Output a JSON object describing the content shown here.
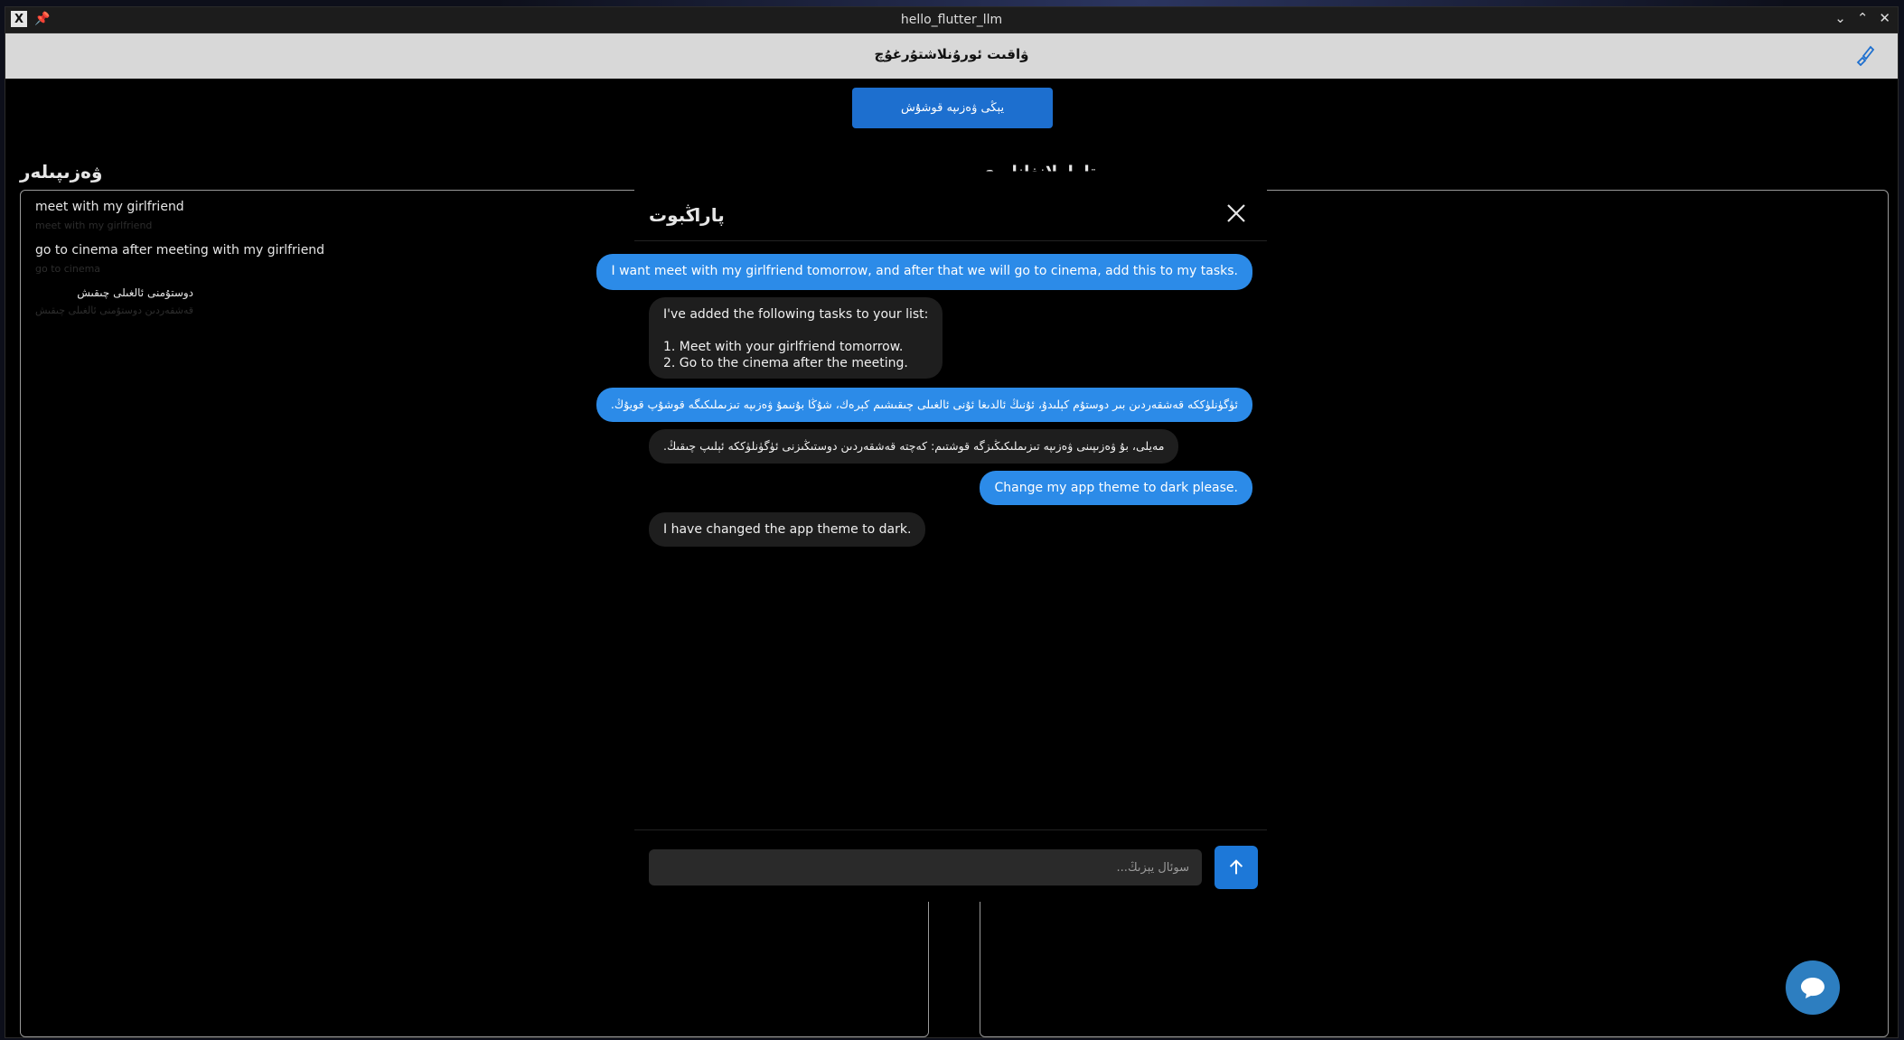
{
  "window": {
    "title": "hello_flutter_llm"
  },
  "appbar": {
    "title": "ۋاقىت ئورۇنلاشتۇرغۇچ"
  },
  "actions": {
    "add_task_label": "يېڭى ۋەزىپە قوشۇش"
  },
  "tasks": {
    "heading": "ۋەزىپىلەر",
    "items": [
      {
        "title": "meet with my girlfriend",
        "subtitle": "meet with my girlfriend"
      },
      {
        "title": "go to cinema after meeting with my girlfriend",
        "subtitle": "go to cinema"
      },
      {
        "title": "دوستۇمنى ئالغىلى چىقىش",
        "subtitle": "قەشقەردىن دوستۇمنى ئالغىلى چىقىش"
      }
    ]
  },
  "right_panel": {
    "heading": "تاماملانغانلىرى"
  },
  "chat": {
    "title": "پاراڭبوت",
    "messages": [
      {
        "role": "user",
        "text": "I want meet with my girlfriend tomorrow, and after that we will go to cinema, add this to my tasks."
      },
      {
        "role": "bot",
        "lines": [
          "I've added the following tasks to your list:",
          "",
          "1. Meet with your girlfriend tomorrow.",
          "2. Go to the cinema after the meeting."
        ]
      },
      {
        "role": "user",
        "text": "ئۈگۈنلۈككە قەشقەردىن بىر دوستۇم كېلىدۇ، ئۇنىڭ ئالدىغا ئۇنى ئالغىلى چىقىشىم كېرەك، شۇڭا بۇنىمۇ ۋەزىپە تىزىملىكىگە قوشۇپ قويۇڭ."
      },
      {
        "role": "bot",
        "text": "مەيلى، بۇ ۋەزىپىنى ۋەزىپە تىزىملىكىڭىزگە قوشتىم: كەچتە قەشقەردىن دوستىڭىزنى ئۈگۈنلۈككە ئېلىپ چىقىڭ."
      },
      {
        "role": "user",
        "text": "Change my app theme to dark please."
      },
      {
        "role": "bot",
        "text": "I have changed the app theme to dark."
      }
    ],
    "input_placeholder": "سوئال يېزىڭ..."
  },
  "colors": {
    "accent": "#2c8be8",
    "primary_button": "#1d6fcf",
    "appbar_bg": "#d8d8d8",
    "bot_bubble": "#1e1e1e",
    "background": "#000000"
  },
  "icons": {
    "appbar_right": "paint-brush-icon",
    "chat_close": "close-icon",
    "send": "arrow-up-icon",
    "fab": "chat-bubble-icon"
  }
}
